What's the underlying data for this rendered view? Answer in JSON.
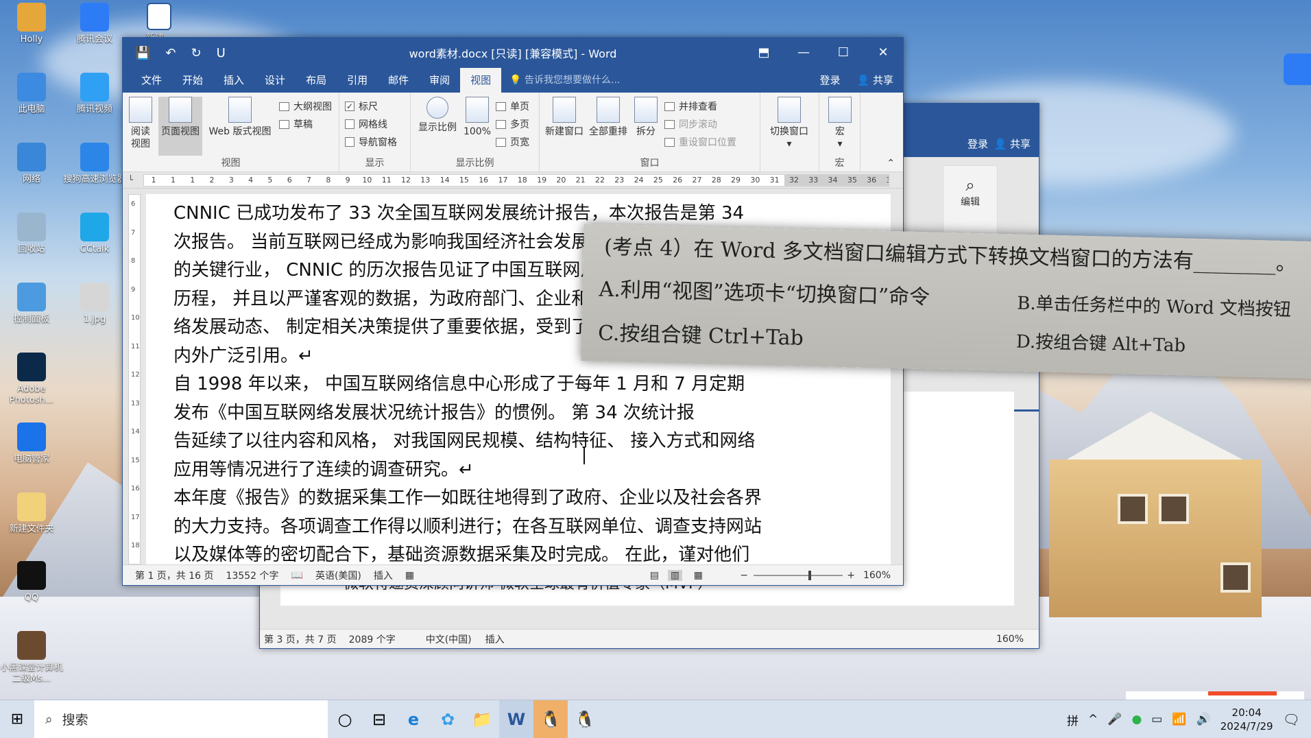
{
  "desktop": {
    "icons": [
      {
        "label": "Holly",
        "color": "#e5a63a"
      },
      {
        "label": "腾讯会议",
        "color": "#2d7cf6"
      },
      {
        "label": "此电脑",
        "color": "#3d8be0"
      },
      {
        "label": "腾讯视频",
        "color": "#2fa0f3"
      },
      {
        "label": "网络",
        "color": "#3a86d8"
      },
      {
        "label": "搜狗高速浏览器",
        "color": "#2b86e8"
      },
      {
        "label": "回收站",
        "color": "#9ab6cf"
      },
      {
        "label": "CCtalk",
        "color": "#1fa7e8"
      },
      {
        "label": "控制面板",
        "color": "#4c9be0"
      },
      {
        "label": "1.jpg",
        "color": "#d6d6d6"
      },
      {
        "label": "Adobe Photosh...",
        "color": "#0b2a49"
      },
      {
        "label": "电脑管家",
        "color": "#1a73e8"
      },
      {
        "label": "新建文件夹",
        "color": "#f1d27a"
      },
      {
        "label": "QQ",
        "color": "#111111"
      },
      {
        "label": "小黑课堂计算机二级Ms...",
        "color": "#6b4b2f"
      }
    ],
    "top_icon_label": "新建..."
  },
  "back_window": {
    "ribbon_right": {
      "login": "登录",
      "share": "共享"
    },
    "edit_label": "编辑",
    "doc_line": "微软特邀资深顾问讲师                          微软全球最有价值专家（MVP）",
    "status": {
      "page": "第 3 页，共 7 页",
      "words": "2089 个字",
      "lang": "中文(中国)",
      "mode": "插入",
      "zoom": "160%"
    }
  },
  "word": {
    "title": "word素材.docx [只读] [兼容模式] - Word",
    "quick_access": [
      "💾",
      "↶",
      "↻",
      "U"
    ],
    "tabs": [
      "文件",
      "开始",
      "插入",
      "设计",
      "布局",
      "引用",
      "邮件",
      "审阅",
      "视图"
    ],
    "active_tab": "视图",
    "tell_me": "告诉我您想要做什么...",
    "login": "登录",
    "share": "共享",
    "ribbon": {
      "views": {
        "read": "阅读\n视图",
        "print": "页面视图",
        "web": "Web 版式视图",
        "outline": "大纲视图",
        "draft": "草稿",
        "group": "视图"
      },
      "show": {
        "ruler": "标尺",
        "grid": "网格线",
        "nav": "导航窗格",
        "group": "显示"
      },
      "zoom": {
        "zoom": "显示比例",
        "p100": "100%",
        "one": "单页",
        "multi": "多页",
        "width": "页宽",
        "group": "显示比例"
      },
      "window": {
        "new": "新建窗口",
        "arrange": "全部重排",
        "split": "拆分",
        "side": "并排查看",
        "sync": "同步滚动",
        "reset": "重设窗口位置",
        "switch": "切换窗口",
        "group": "窗口"
      },
      "macro": {
        "macro": "宏",
        "group": "宏"
      }
    },
    "ruler_ticks": [
      "1",
      "1",
      "1",
      "2",
      "3",
      "4",
      "5",
      "6",
      "7",
      "8",
      "9",
      "10",
      "11",
      "12",
      "13",
      "14",
      "15",
      "16",
      "17",
      "18",
      "19",
      "20",
      "21",
      "22",
      "23",
      "24",
      "25",
      "26",
      "27",
      "28",
      "29",
      "30",
      "31",
      "32",
      "33",
      "34",
      "35",
      "36",
      "37"
    ],
    "vruler_ticks": [
      "6",
      "7",
      "8",
      "9",
      "10",
      "11",
      "12",
      "13",
      "14",
      "15",
      "16",
      "17",
      "18"
    ],
    "document": [
      "CNNIC 已成功发布了 33 次全国互联网发展统计报告，本次报告是第 34",
      "次报告。 当前互联网已经成为影响我国经济社会发展、改变人们生活形态",
      "的关键行业， CNNIC 的历次报告见证了中国互联网从起步到腾飞的全部",
      "历程， 并且以严谨客观的数据，为政府部门、企业和社会公众了解中国网",
      "络发展动态、 制定相关决策提供了重要依据，受到了各级政府机构和海",
      "内外广泛引用。↵",
      "自 1998 年以来， 中国互联网络信息中心形成了于每年 1 月和 7 月定期",
      "发布《中国互联网络发展状况统计报告》的惯例。 第 34 次统计报",
      "告延续了以往内容和风格， 对我国网民规模、结构特征、 接入方式和网络",
      "应用等情况进行了连续的调查研究。↵",
      "本年度《报告》的数据采集工作一如既往地得到了政府、企业以及社会各界",
      "的大力支持。各项调查工作得以顺利进行；在各互联网单位、调查支持网站",
      "以及媒体等的密切配合下，基础资源数据采集及时完成。 在此，谨对他们"
    ],
    "status": {
      "page": "第 1 页，共 16 页",
      "words": "13552 个字",
      "lang": "英语(美国)",
      "mode": "插入",
      "zoom": "160%"
    }
  },
  "question": {
    "line1": "(考点 4）在  Word  多文档窗口编辑方式下转换文档窗口的方法有________。",
    "a": "A.利用“视图”选项卡“切换窗口”命令",
    "b": "B.单击任务栏中的 Word 文档按钮",
    "c": "C.按组合键  Ctrl+Tab",
    "d": "D.按组合键  Alt+Tab"
  },
  "taskbar": {
    "search": "搜索",
    "apps": [
      "○",
      "⊟",
      "e",
      "✿",
      "📁",
      "W",
      "🐧",
      "🐧"
    ],
    "tray": [
      "拼",
      "^",
      "🎤",
      "●",
      "▭",
      "📶",
      "🔊"
    ],
    "time": "20:04",
    "date": "2024/7/29"
  }
}
